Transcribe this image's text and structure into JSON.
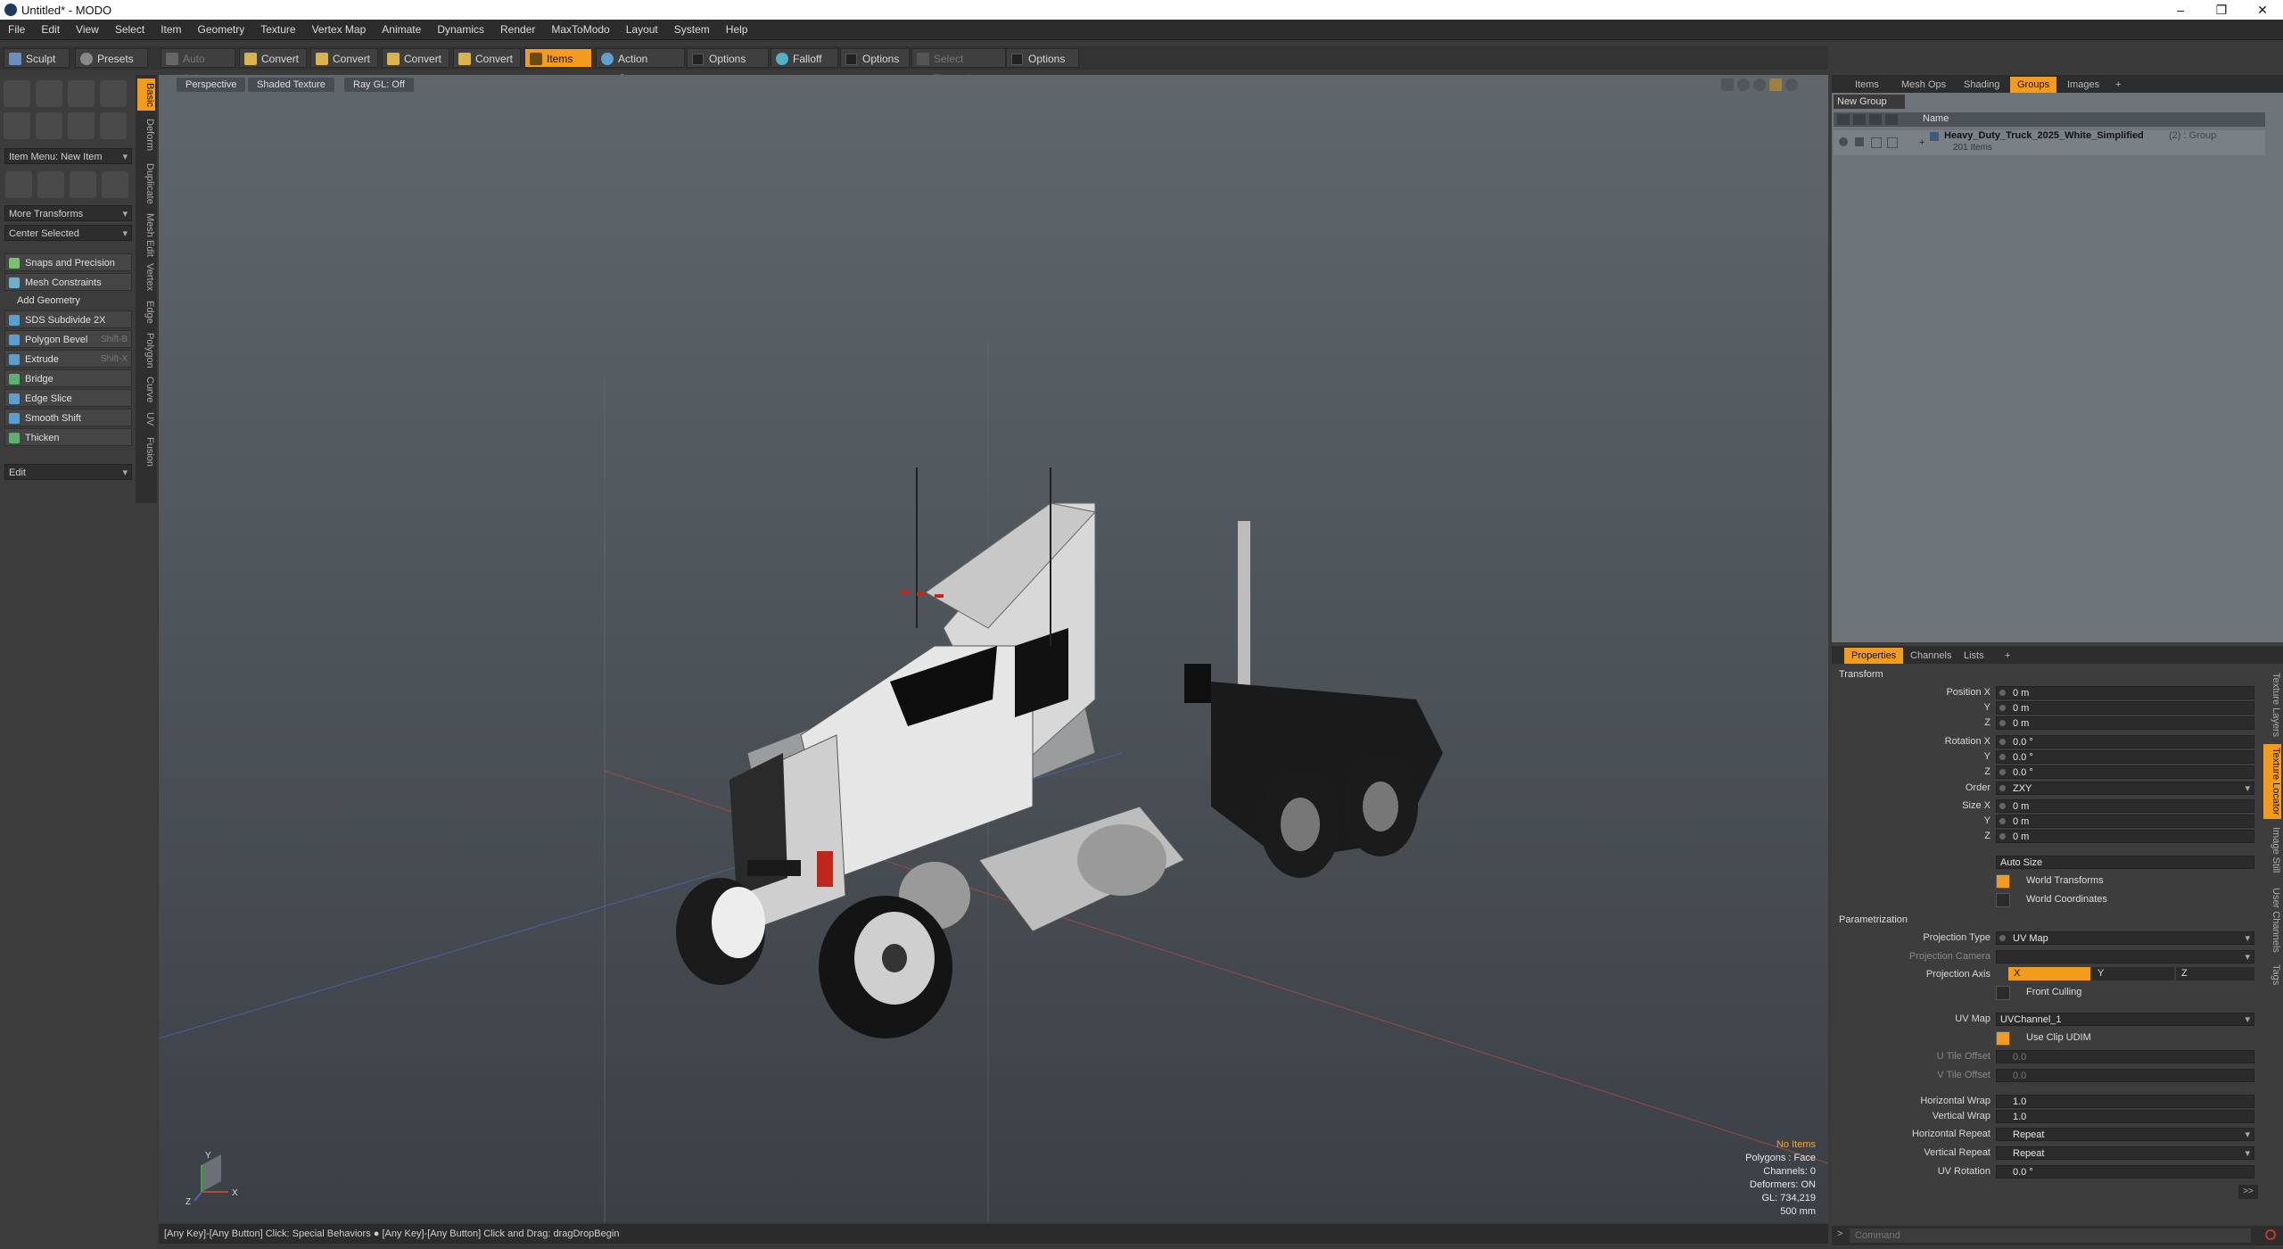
{
  "window": {
    "title": "Untitled* - MODO",
    "controls": [
      "–",
      "❐",
      "✕"
    ]
  },
  "menu": [
    "File",
    "Edit",
    "View",
    "Select",
    "Item",
    "Geometry",
    "Texture",
    "Vertex Map",
    "Animate",
    "Dynamics",
    "Render",
    "MaxToModo",
    "Layout",
    "System",
    "Help"
  ],
  "toolbar": {
    "sculpt": "Sculpt",
    "presets": "Presets",
    "auto_select": "Auto Select",
    "convert": "Convert",
    "items": "Items",
    "action_center": "Action Center",
    "options": "Options",
    "falloff": "Falloff",
    "select_through": "Select Through"
  },
  "left_panel": {
    "item_menu": "Item Menu: New Item",
    "more_transforms": "More Transforms",
    "center_selected": "Center Selected",
    "snaps": "Snaps and Precision",
    "mesh_constraints": "Mesh Constraints",
    "add_geometry": "Add Geometry",
    "tools": [
      {
        "label": "SDS Subdivide 2X",
        "shortcut": ""
      },
      {
        "label": "Polygon Bevel",
        "shortcut": "Shift-B"
      },
      {
        "label": "Extrude",
        "shortcut": "Shift-X"
      },
      {
        "label": "Bridge",
        "shortcut": ""
      },
      {
        "label": "Edge Slice",
        "shortcut": ""
      },
      {
        "label": "Smooth Shift",
        "shortcut": ""
      },
      {
        "label": "Thicken",
        "shortcut": ""
      }
    ],
    "edit": "Edit",
    "vertical_tabs": [
      "Basic",
      "Deform",
      "Duplicate",
      "Mesh Edit",
      "Vertex",
      "Edge",
      "Polygon",
      "Curve",
      "UV",
      "Fusion"
    ]
  },
  "viewport": {
    "perspective": "Perspective",
    "shading": "Shaded Texture",
    "raygl": "Ray GL: Off",
    "hud": {
      "items": "No Items",
      "polygons": "Polygons : Face",
      "channels": "Channels: 0",
      "deformers": "Deformers: ON",
      "gl": "GL: 734,219",
      "scale": "500 mm"
    },
    "axis_labels": {
      "y": "Y",
      "x": "X",
      "z": "Z"
    }
  },
  "status": "[Any Key]-[Any Button] Click: Special Behaviors ● [Any Key]-[Any Button] Click and Drag: dragDropBegin",
  "items_panel": {
    "tabs": [
      "Items",
      "Mesh Ops",
      "Shading",
      "Groups",
      "Images",
      "+"
    ],
    "new_group": "New Group",
    "name_header": "Name",
    "group_name": "Heavy_Duty_Truck_2025_White_Simplified",
    "group_suffix": "(2) : Group",
    "group_count": "201 Items"
  },
  "properties": {
    "tabs": [
      "Properties",
      "Channels",
      "Lists",
      "+"
    ],
    "transform": "Transform",
    "position_x": "Position X",
    "y": "Y",
    "z": "Z",
    "rotation_x": "Rotation X",
    "order": "Order",
    "size_x": "Size X",
    "pos_vals": [
      "0 m",
      "0 m",
      "0 m"
    ],
    "rot_vals": [
      "0.0 °",
      "0.0 °",
      "0.0 °"
    ],
    "order_val": "ZXY",
    "size_vals": [
      "0 m",
      "0 m",
      "0 m"
    ],
    "auto_size": "Auto Size",
    "world_transforms": "World Transforms",
    "world_coordinates": "World Coordinates",
    "parametrization": "Parametrization",
    "projection_type": "Projection Type",
    "projection_type_val": "UV Map",
    "projection_camera": "Projection Camera",
    "projection_axis": "Projection Axis",
    "axes": [
      "X",
      "Y",
      "Z"
    ],
    "front_culling": "Front Culling",
    "uv_map": "UV Map",
    "uv_map_val": "UVChannel_1",
    "use_clip_udim": "Use Clip UDIM",
    "u_tile_offset": "U Tile Offset",
    "u_tile_val": "0.0",
    "v_tile_offset": "V Tile Offset",
    "v_tile_val": "0.0",
    "horizontal_wrap": "Horizontal Wrap",
    "horizontal_wrap_val": "1.0",
    "vertical_wrap": "Vertical Wrap",
    "vertical_wrap_val": "1.0",
    "horizontal_repeat": "Horizontal Repeat",
    "horizontal_repeat_val": "Repeat",
    "vertical_repeat": "Vertical Repeat",
    "vertical_repeat_val": "Repeat",
    "uv_rotation": "UV Rotation",
    "uv_rotation_val": "0.0 °",
    "more": ">>",
    "side_tabs": [
      "Texture Layers",
      "Texture Locator",
      "Image Still",
      "User Channels",
      "Tags"
    ]
  },
  "command": {
    "prompt": ">",
    "placeholder": "Command"
  },
  "colors": {
    "accent": "#f29b1d",
    "panel": "#3c3c3c",
    "viewport_top": "#5f666c"
  }
}
